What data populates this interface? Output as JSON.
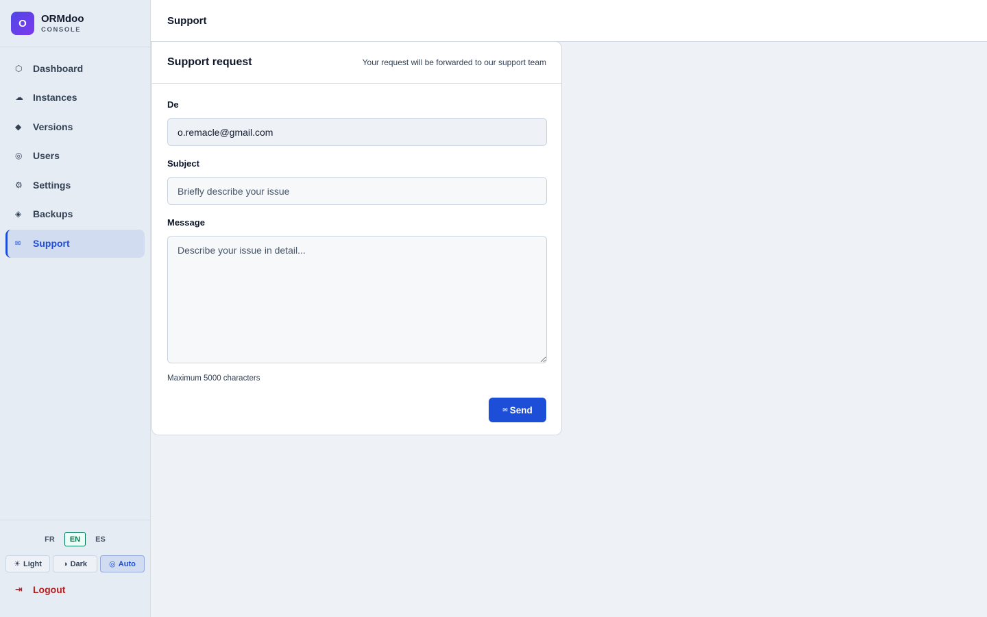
{
  "brand": {
    "logo_letter": "O",
    "name": "ORMdoo",
    "subtitle": "CONSOLE"
  },
  "sidebar": {
    "items": [
      {
        "label": "Dashboard",
        "icon": "hexagon-icon",
        "glyph": "⬡",
        "active": false
      },
      {
        "label": "Instances",
        "icon": "cloud-icon",
        "glyph": "☁",
        "active": false
      },
      {
        "label": "Versions",
        "icon": "diamond-icon",
        "glyph": "◆",
        "active": false
      },
      {
        "label": "Users",
        "icon": "user-circle-icon",
        "glyph": "◎",
        "active": false
      },
      {
        "label": "Settings",
        "icon": "gear-icon",
        "glyph": "⚙",
        "active": false
      },
      {
        "label": "Backups",
        "icon": "layers-icon",
        "glyph": "◈",
        "active": false
      },
      {
        "label": "Support",
        "icon": "mail-icon",
        "glyph": "✉",
        "active": true
      }
    ],
    "languages": [
      "FR",
      "EN",
      "ES"
    ],
    "active_language": "EN",
    "themes": [
      {
        "label": "Light",
        "icon": "sun-icon",
        "glyph": "☀"
      },
      {
        "label": "Dark",
        "icon": "half-moon-icon",
        "glyph": "◑"
      },
      {
        "label": "Auto",
        "icon": "auto-icon",
        "glyph": "◎"
      }
    ],
    "active_theme": "Auto",
    "logout_label": "Logout",
    "logout_glyph": "⇥"
  },
  "header": {
    "title": "Support"
  },
  "form": {
    "title": "Support request",
    "subtitle": "Your request will be forwarded to our support team",
    "from_label": "De",
    "from_value": "o.remacle@gmail.com",
    "subject_label": "Subject",
    "subject_placeholder": "Briefly describe your issue",
    "message_label": "Message",
    "message_placeholder": "Describe your issue in detail...",
    "message_hint": "Maximum 5000 characters",
    "send_label": "Send",
    "send_glyph": "✉"
  },
  "colors": {
    "accent": "#1d4ed8",
    "danger": "#b91c1c",
    "success": "#047857"
  }
}
